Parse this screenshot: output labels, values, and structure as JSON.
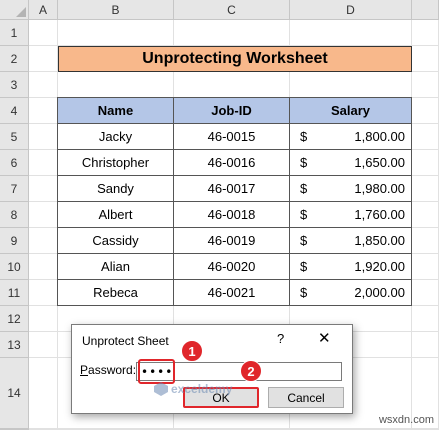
{
  "columns": [
    "A",
    "B",
    "C",
    "D"
  ],
  "rows": [
    "1",
    "2",
    "3",
    "4",
    "5",
    "6",
    "7",
    "8",
    "9",
    "10",
    "11",
    "12",
    "13",
    "14"
  ],
  "title": "Unprotecting Worksheet",
  "table": {
    "headers": [
      "Name",
      "Job-ID",
      "Salary"
    ],
    "currency": "$",
    "records": [
      {
        "name": "Jacky",
        "job_id": "46-0015",
        "salary": "1,800.00"
      },
      {
        "name": "Christopher",
        "job_id": "46-0016",
        "salary": "1,650.00"
      },
      {
        "name": "Sandy",
        "job_id": "46-0017",
        "salary": "1,980.00"
      },
      {
        "name": "Albert",
        "job_id": "46-0018",
        "salary": "1,760.00"
      },
      {
        "name": "Cassidy",
        "job_id": "46-0019",
        "salary": "1,850.00"
      },
      {
        "name": "Alian",
        "job_id": "46-0020",
        "salary": "1,920.00"
      },
      {
        "name": "Rebeca",
        "job_id": "46-0021",
        "salary": "2,000.00"
      }
    ]
  },
  "dialog": {
    "title": "Unprotect Sheet",
    "help": "?",
    "close": "✕",
    "password_label": "Password:",
    "password_value": "••••",
    "ok_label": "OK",
    "cancel_label": "Cancel"
  },
  "badges": [
    "1",
    "2"
  ],
  "watermark": "exceldemy",
  "site_mark": "wsxdn.com",
  "colors": {
    "title_fill": "#f8b88b",
    "header_fill": "#b4c6e7",
    "highlight": "#e0262b"
  }
}
